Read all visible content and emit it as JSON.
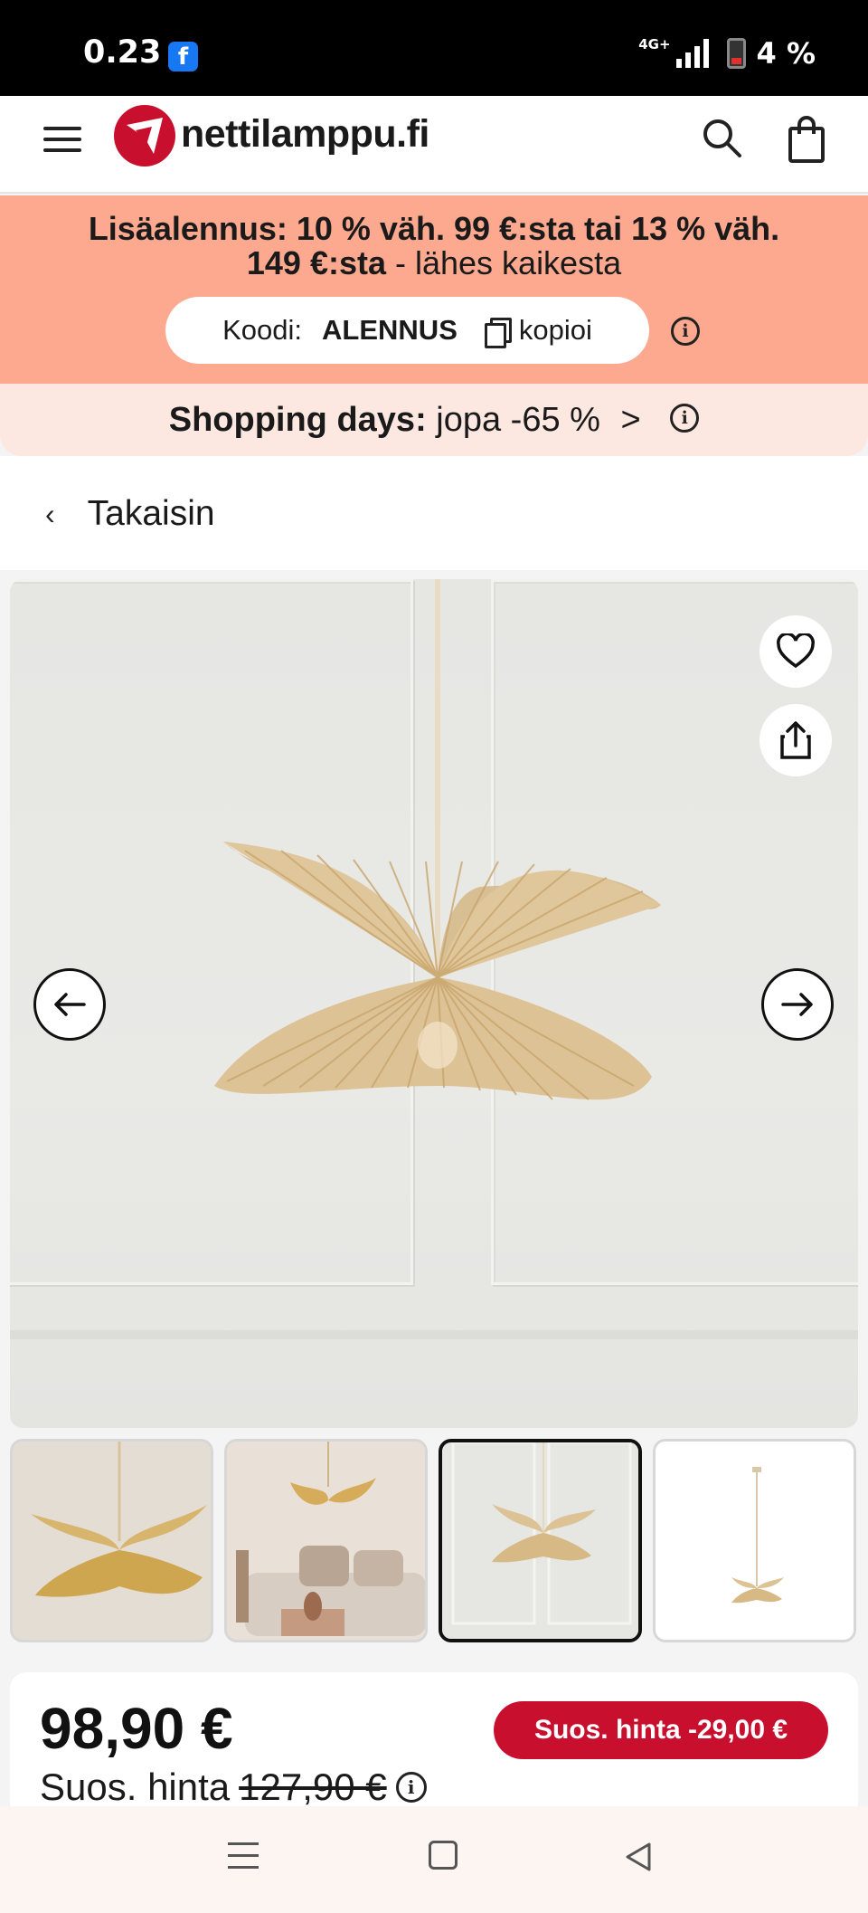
{
  "status_bar": {
    "time": "0.23",
    "app_badge": "f",
    "network": "4G+",
    "battery": "4 %"
  },
  "header": {
    "logo_text": "nettilamppu.fi"
  },
  "promo": {
    "line1": "Lisäalennus: 10 % väh. 99 €:sta tai 13 % väh.",
    "line2_bold": "149 €:sta",
    "line2_rest": " - lähes kaikesta",
    "code_label": "Koodi:",
    "code_value": "ALENNUS",
    "copy_label": "kopioi",
    "info_glyph": "i"
  },
  "shopping_days": {
    "label": "Shopping days:",
    "text": " jopa -65 %",
    "chevron": ">",
    "info_glyph": "i"
  },
  "back": {
    "chevron": "‹",
    "label": "Takaisin"
  },
  "gallery": {
    "selected_index": 2,
    "thumbnail_count": 4
  },
  "price": {
    "current": "98,90 €",
    "badge": "Suos. hinta -29,00 €",
    "ref_label": "Suos. hinta",
    "ref_value": "127,90 €",
    "info_glyph": "i"
  },
  "colors": {
    "brand_red": "#c8102e",
    "promo_bg": "#fca98f",
    "shopdays_bg": "#fde8e1"
  }
}
